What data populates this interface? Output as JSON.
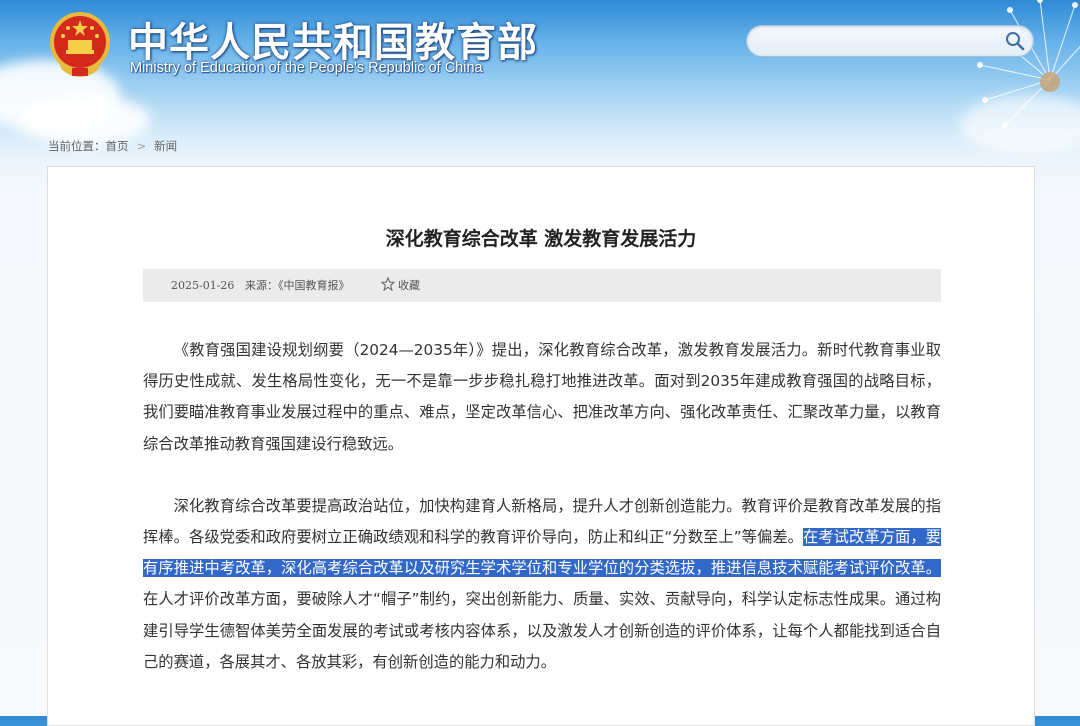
{
  "header": {
    "title": "中华人民共和国教育部",
    "subtitle": "Ministry of Education of the People's Republic of China",
    "emblem_icon": "national-emblem-icon"
  },
  "search": {
    "value": "",
    "placeholder": "",
    "icon": "search-icon"
  },
  "breadcrumb": {
    "prefix": "当前位置：",
    "items": [
      "首页",
      "新闻"
    ],
    "separator": ">"
  },
  "article": {
    "title": "深化教育综合改革 激发教育发展活力",
    "meta": {
      "date": "2025-01-26",
      "source": "来源：《中国教育报》",
      "favorite_label": "收藏",
      "favorite_icon": "star-icon"
    },
    "paragraphs": [
      {
        "text": "《教育强国建设规划纲要（2024—2035年）》提出，深化教育综合改革，激发教育发展活力。新时代教育事业取得历史性成就、发生格局性变化，无一不是靠一步步稳扎稳打地推进改革。面对到2035年建成教育强国的战略目标，我们要瞄准教育事业发展过程中的重点、难点，坚定改革信心、把准改革方向、强化改革责任、汇聚改革力量，以教育综合改革推动教育强国建设行稳致远。"
      },
      {
        "before": "深化教育综合改革要提高政治站位，加快构建育人新格局，提升人才创新创造能力。教育评价是教育改革发展的指挥棒。各级党委和政府要树立正确政绩观和科学的教育评价导向，防止和纠正“分数至上”等偏差。",
        "highlighted": "在考试改革方面，要有序推进中考改革，深化高考综合改革以及研究生学术学位和专业学位的分类选拔，推进信息技术赋能考试评价改革。",
        "after": "在人才评价改革方面，要破除人才“帽子”制约，突出创新能力、质量、实效、贡献导向，科学认定标志性成果。通过构建引导学生德智体美劳全面发展的考试或考核内容体系，以及激发人才创新创造的评价体系，让每个人都能找到适合自己的赛道，各展其才、各放其彩，有创新创造的能力和动力。"
      }
    ]
  },
  "colors": {
    "header_blue": "#2f8ad6",
    "selection_highlight": "#3268c8",
    "meta_bar": "#ebebeb"
  }
}
